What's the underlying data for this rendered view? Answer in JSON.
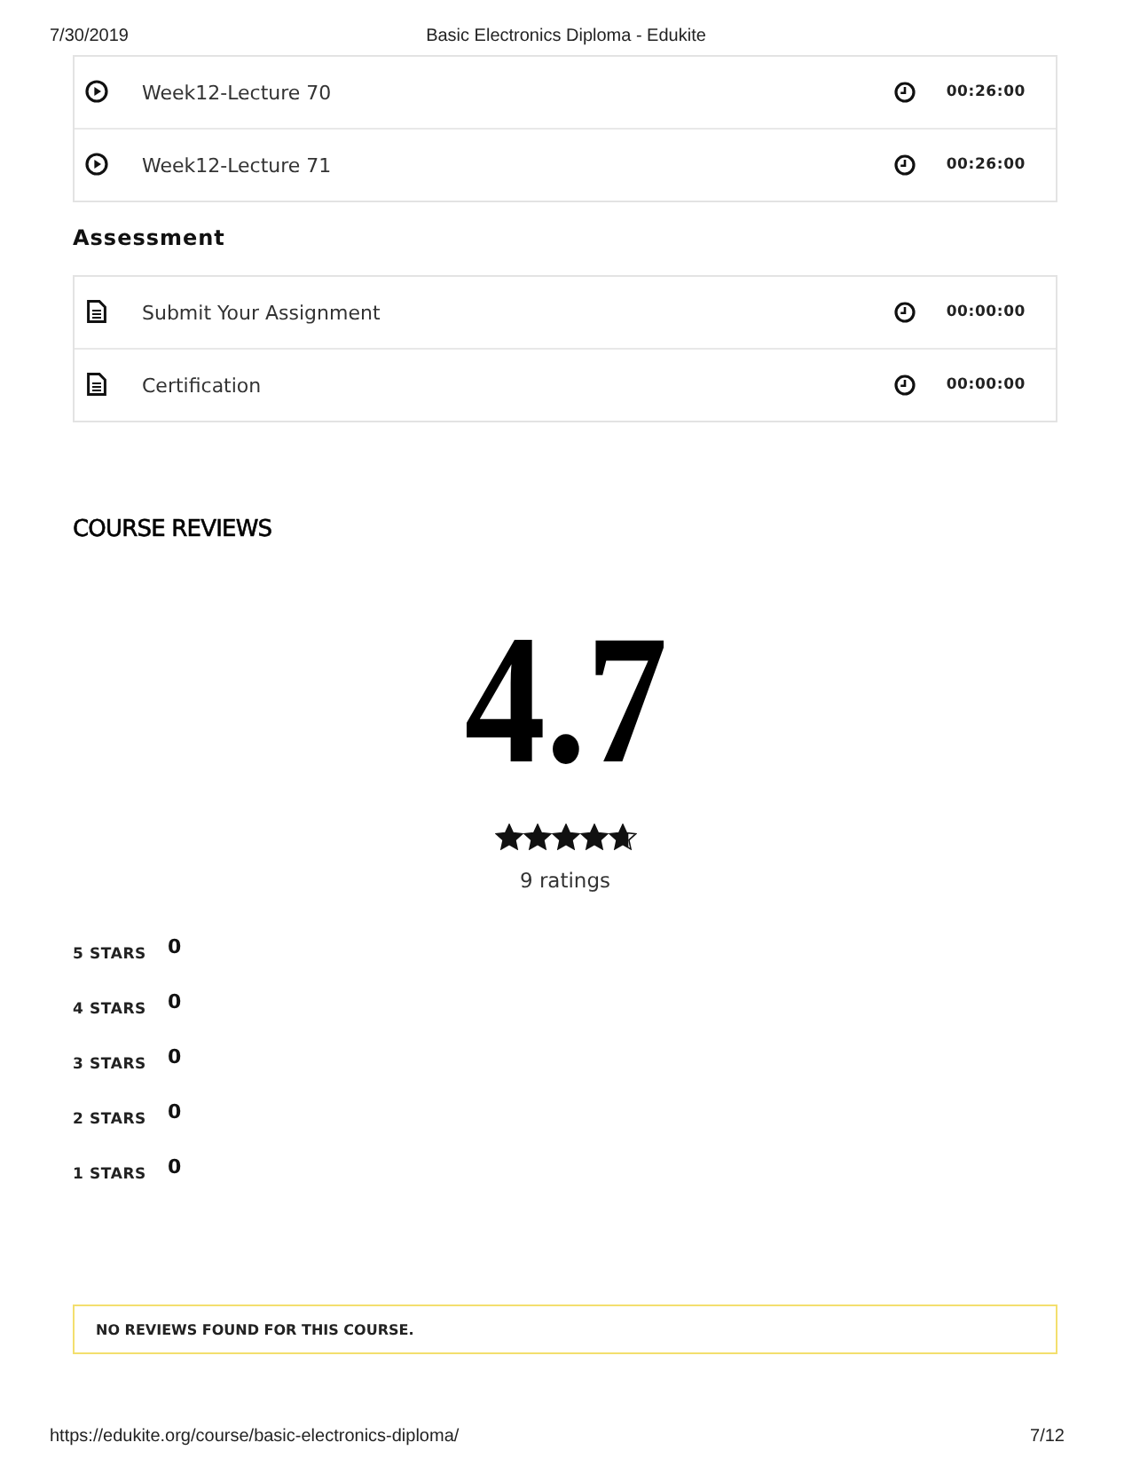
{
  "print_header": {
    "date": "7/30/2019",
    "title": "Basic Electronics Diploma - Edukite"
  },
  "lessons": [
    {
      "kind": "video",
      "title": "Week12-Lecture 70",
      "duration": "00:26:00"
    },
    {
      "kind": "video",
      "title": "Week12-Lecture 71",
      "duration": "00:26:00"
    }
  ],
  "assessment": {
    "heading": "Assessment",
    "items": [
      {
        "kind": "document",
        "title": "Submit Your Assignment",
        "duration": "00:00:00"
      },
      {
        "kind": "document",
        "title": "Certification",
        "duration": "00:00:00"
      }
    ]
  },
  "reviews": {
    "heading": "COURSE REVIEWS",
    "average": "4.7",
    "stars": 4.7,
    "ratings_count": "9 ratings",
    "breakdown": [
      {
        "label": "5 STARS",
        "count": "0"
      },
      {
        "label": "4 STARS",
        "count": "0"
      },
      {
        "label": "3 STARS",
        "count": "0"
      },
      {
        "label": "2 STARS",
        "count": "0"
      },
      {
        "label": "1 STARS",
        "count": "0"
      }
    ],
    "notice": "NO REVIEWS FOUND FOR THIS COURSE."
  },
  "print_footer": {
    "url": "https://edukite.org/course/basic-electronics-diploma/",
    "page": "7/12"
  }
}
